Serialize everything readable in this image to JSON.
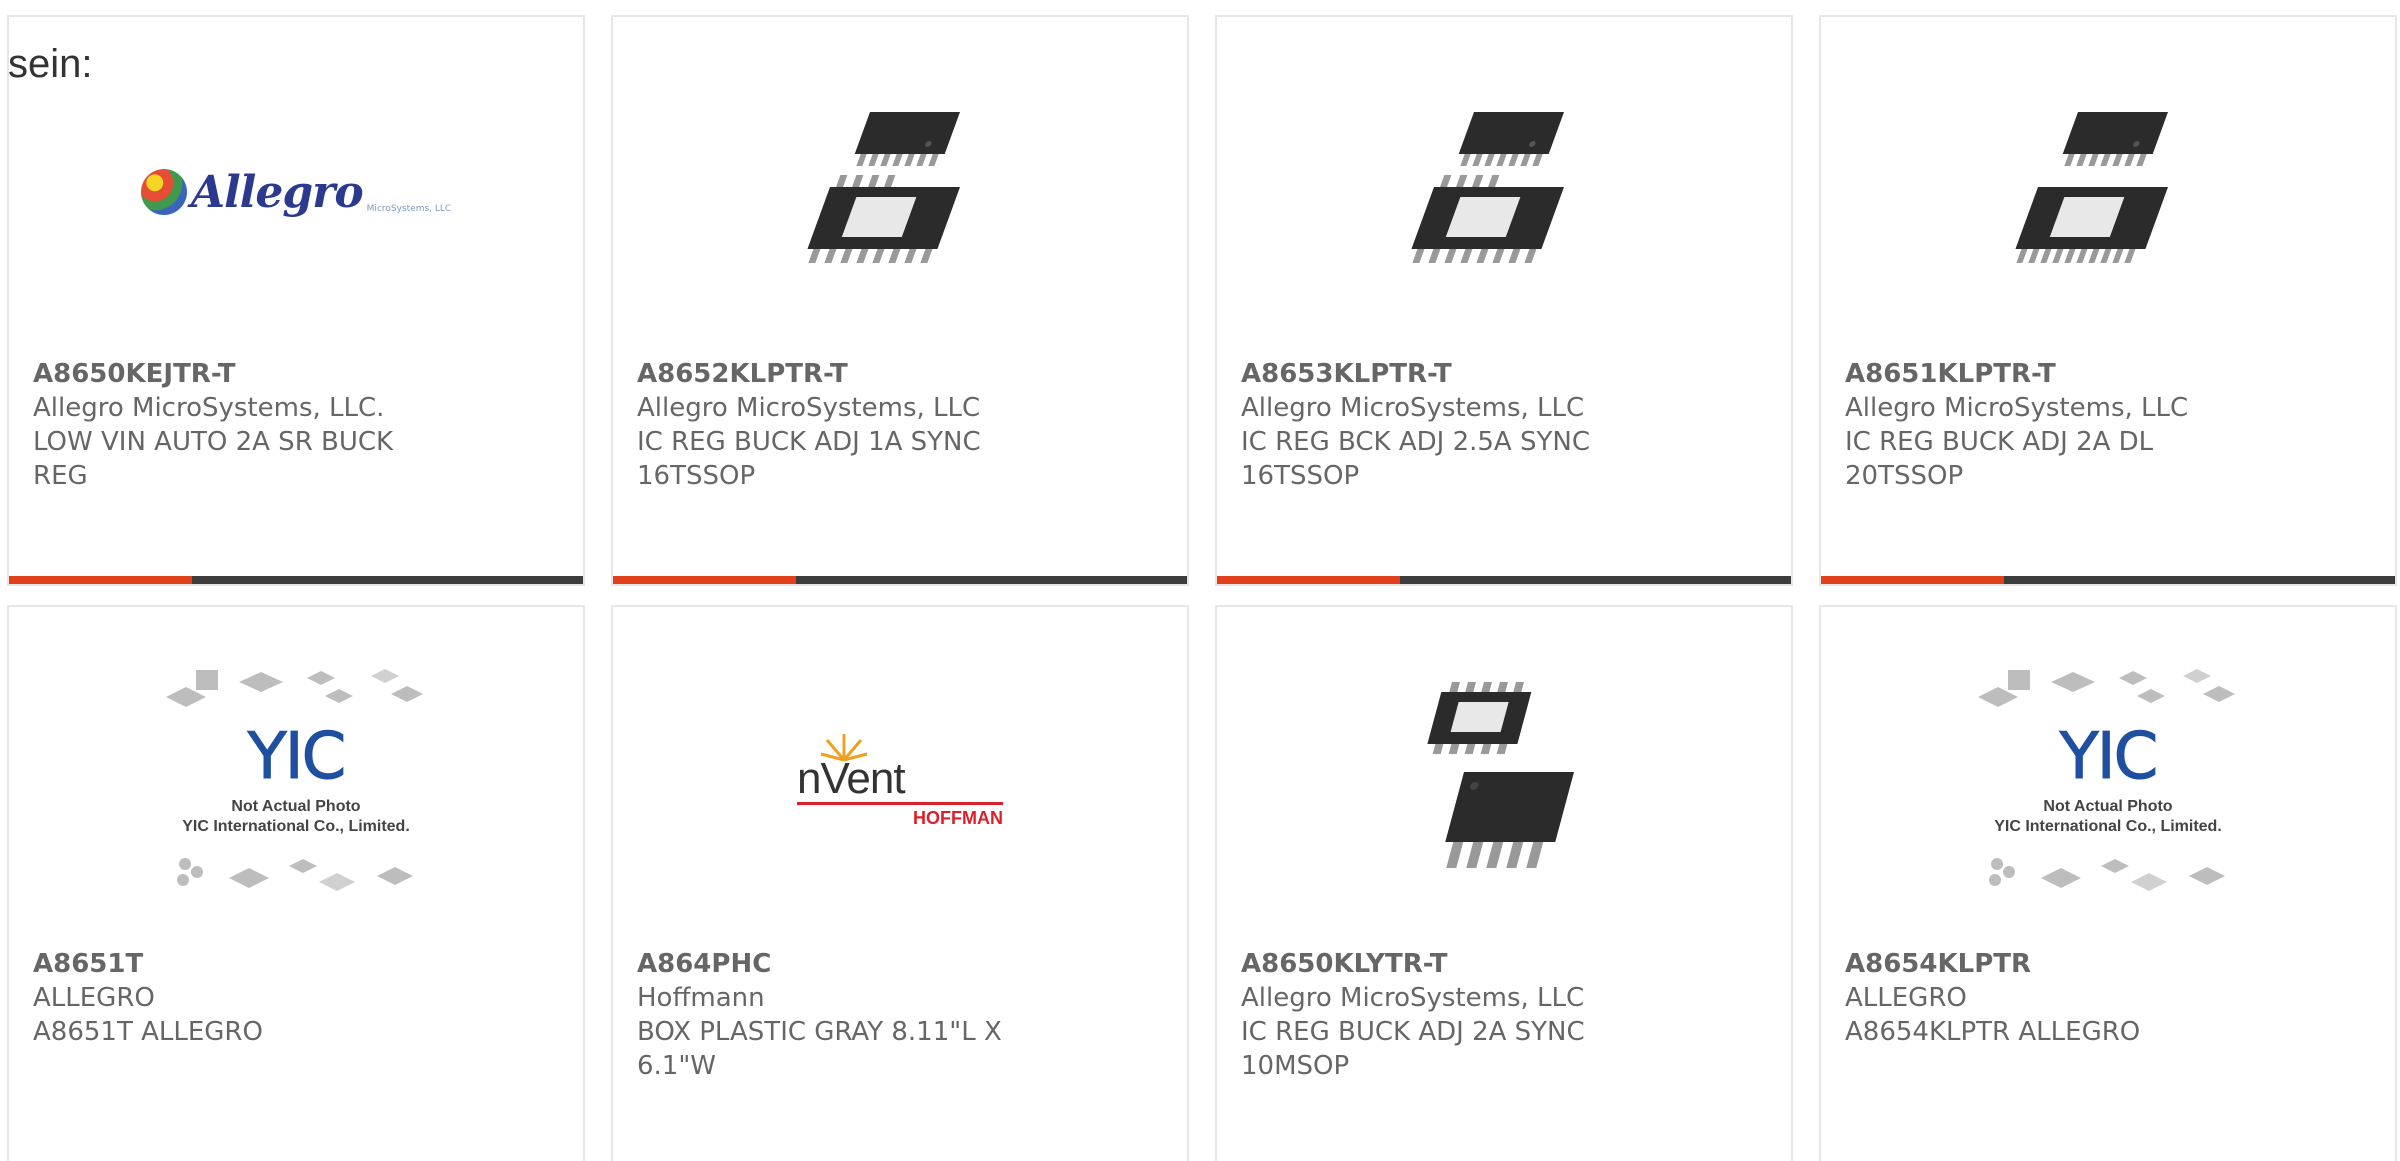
{
  "intro_text": "sein:",
  "colors": {
    "accent": "#e0401a",
    "bar": "#3c3c3c",
    "border": "#e6e6e6",
    "text": "#666666"
  },
  "products": [
    {
      "part": "A8650KEJTR-T",
      "manufacturer": "Allegro MicroSystems, LLC.",
      "description": "LOW VIN AUTO 2A SR BUCK REG",
      "image": "allegro-logo",
      "logo_text": "Allegro",
      "logo_sub": "MicroSystems, LLC"
    },
    {
      "part": "A8652KLPTR-T",
      "manufacturer": "Allegro MicroSystems, LLC",
      "description": "IC REG BUCK ADJ 1A SYNC 16TSSOP",
      "image": "tssop-chip-photo"
    },
    {
      "part": "A8653KLPTR-T",
      "manufacturer": "Allegro MicroSystems, LLC",
      "description": "IC REG BCK ADJ 2.5A SYNC 16TSSOP",
      "image": "tssop-chip-photo"
    },
    {
      "part": "A8651KLPTR-T",
      "manufacturer": "Allegro MicroSystems, LLC",
      "description": "IC REG BUCK ADJ 2A DL 20TSSOP",
      "image": "tssop-chip-photo"
    },
    {
      "part": "A8651T",
      "manufacturer": "ALLEGRO",
      "description": "A8651T ALLEGRO",
      "image": "yic-placeholder",
      "placeholder_line1": "Not Actual Photo",
      "placeholder_line2": "YIC International Co., Limited.",
      "placeholder_mark": "YIC"
    },
    {
      "part": "A864PHC",
      "manufacturer": "Hoffmann",
      "description": "BOX PLASTIC GRAY 8.11\"L X 6.1\"W",
      "image": "nvent-logo",
      "logo_text": "nVent",
      "logo_sub": "HOFFMAN"
    },
    {
      "part": "A8650KLYTR-T",
      "manufacturer": "Allegro MicroSystems, LLC",
      "description": "IC REG BUCK ADJ 2A SYNC 10MSOP",
      "image": "msop-chip-photo"
    },
    {
      "part": "A8654KLPTR",
      "manufacturer": "ALLEGRO",
      "description": "A8654KLPTR ALLEGRO",
      "image": "yic-placeholder",
      "placeholder_line1": "Not Actual Photo",
      "placeholder_line2": "YIC International Co., Limited.",
      "placeholder_mark": "YIC"
    }
  ]
}
